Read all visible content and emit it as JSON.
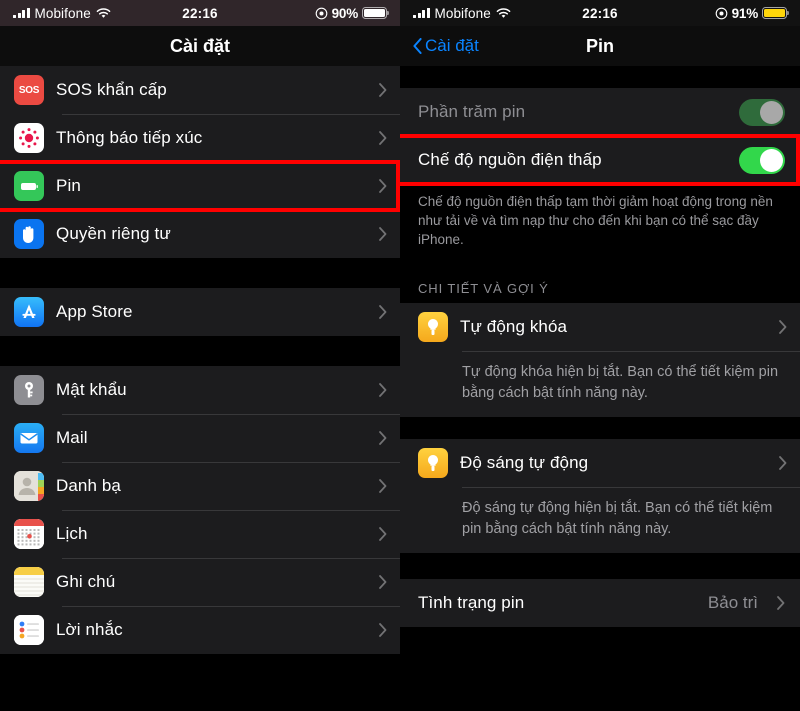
{
  "left": {
    "status": {
      "carrier": "Mobifone",
      "time": "22:16",
      "battery_percent": "90%",
      "battery_color": "#ffffff",
      "signal_icon": "signal-bars-icon",
      "wifi_icon": "wifi-icon",
      "lock_icon": "rotation-lock-icon"
    },
    "nav": {
      "title": "Cài đặt"
    },
    "groups": [
      {
        "items": [
          {
            "label": "SOS khẩn cấp",
            "icon": "sos-icon",
            "color": "#eb4a42"
          },
          {
            "label": "Thông báo tiếp xúc",
            "icon": "exposure-notification-icon",
            "color": "#ffffff"
          },
          {
            "label": "Pin",
            "icon": "battery-icon",
            "color": "#34c759",
            "highlighted": true
          },
          {
            "label": "Quyền riêng tư",
            "icon": "privacy-hand-icon",
            "color": "#0a74f0"
          }
        ]
      },
      {
        "items": [
          {
            "label": "App Store",
            "icon": "app-store-icon",
            "color": "#1d9bf6"
          }
        ]
      },
      {
        "items": [
          {
            "label": "Mật khẩu",
            "icon": "passwords-key-icon",
            "color": "#8e8e93"
          },
          {
            "label": "Mail",
            "icon": "mail-icon",
            "color": "#1d9bf6"
          },
          {
            "label": "Danh bạ",
            "icon": "contacts-icon",
            "color": "#d8d5ce"
          },
          {
            "label": "Lịch",
            "icon": "calendar-icon",
            "color": "#ffffff"
          },
          {
            "label": "Ghi chú",
            "icon": "notes-icon",
            "color": "#f5c518"
          },
          {
            "label": "Lời nhắc",
            "icon": "reminders-icon",
            "color": "#ffffff"
          }
        ]
      }
    ]
  },
  "right": {
    "status": {
      "carrier": "Mobifone",
      "time": "22:16",
      "battery_percent": "91%",
      "battery_color": "#ffd60a",
      "signal_icon": "signal-bars-icon",
      "wifi_icon": "wifi-icon",
      "lock_icon": "rotation-lock-icon"
    },
    "nav": {
      "back_label": "Cài đặt",
      "title": "Pin",
      "back_icon": "chevron-left-icon"
    },
    "battery_percent_row": {
      "label": "Phần trăm pin",
      "toggle_state": "on-disabled"
    },
    "low_power_row": {
      "label": "Chế độ nguồn điện thấp",
      "toggle_state": "on",
      "highlighted": true
    },
    "low_power_footnote": "Chế độ nguồn điện thấp tạm thời giảm hoạt động trong nền như tải về và tìm nạp thư cho đến khi bạn có thể sạc đầy iPhone.",
    "suggestions_header": "CHI TIẾT VÀ GỢI Ý",
    "suggestions": [
      {
        "label": "Tự động khóa",
        "icon": "lightbulb-icon",
        "body": "Tự động khóa hiện bị tắt. Bạn có thể tiết kiệm pin bằng cách bật tính năng này."
      },
      {
        "label": "Độ sáng tự động",
        "icon": "lightbulb-icon",
        "body": "Độ sáng tự động hiện bị tắt. Bạn có thể tiết kiệm pin bằng cách bật tính năng này."
      }
    ],
    "battery_health": {
      "label": "Tình trạng pin",
      "value": "Bảo trì"
    }
  },
  "colors": {
    "highlight": "#ff0000",
    "accent": "#0a84ff",
    "toggle_on": "#32d74b"
  }
}
